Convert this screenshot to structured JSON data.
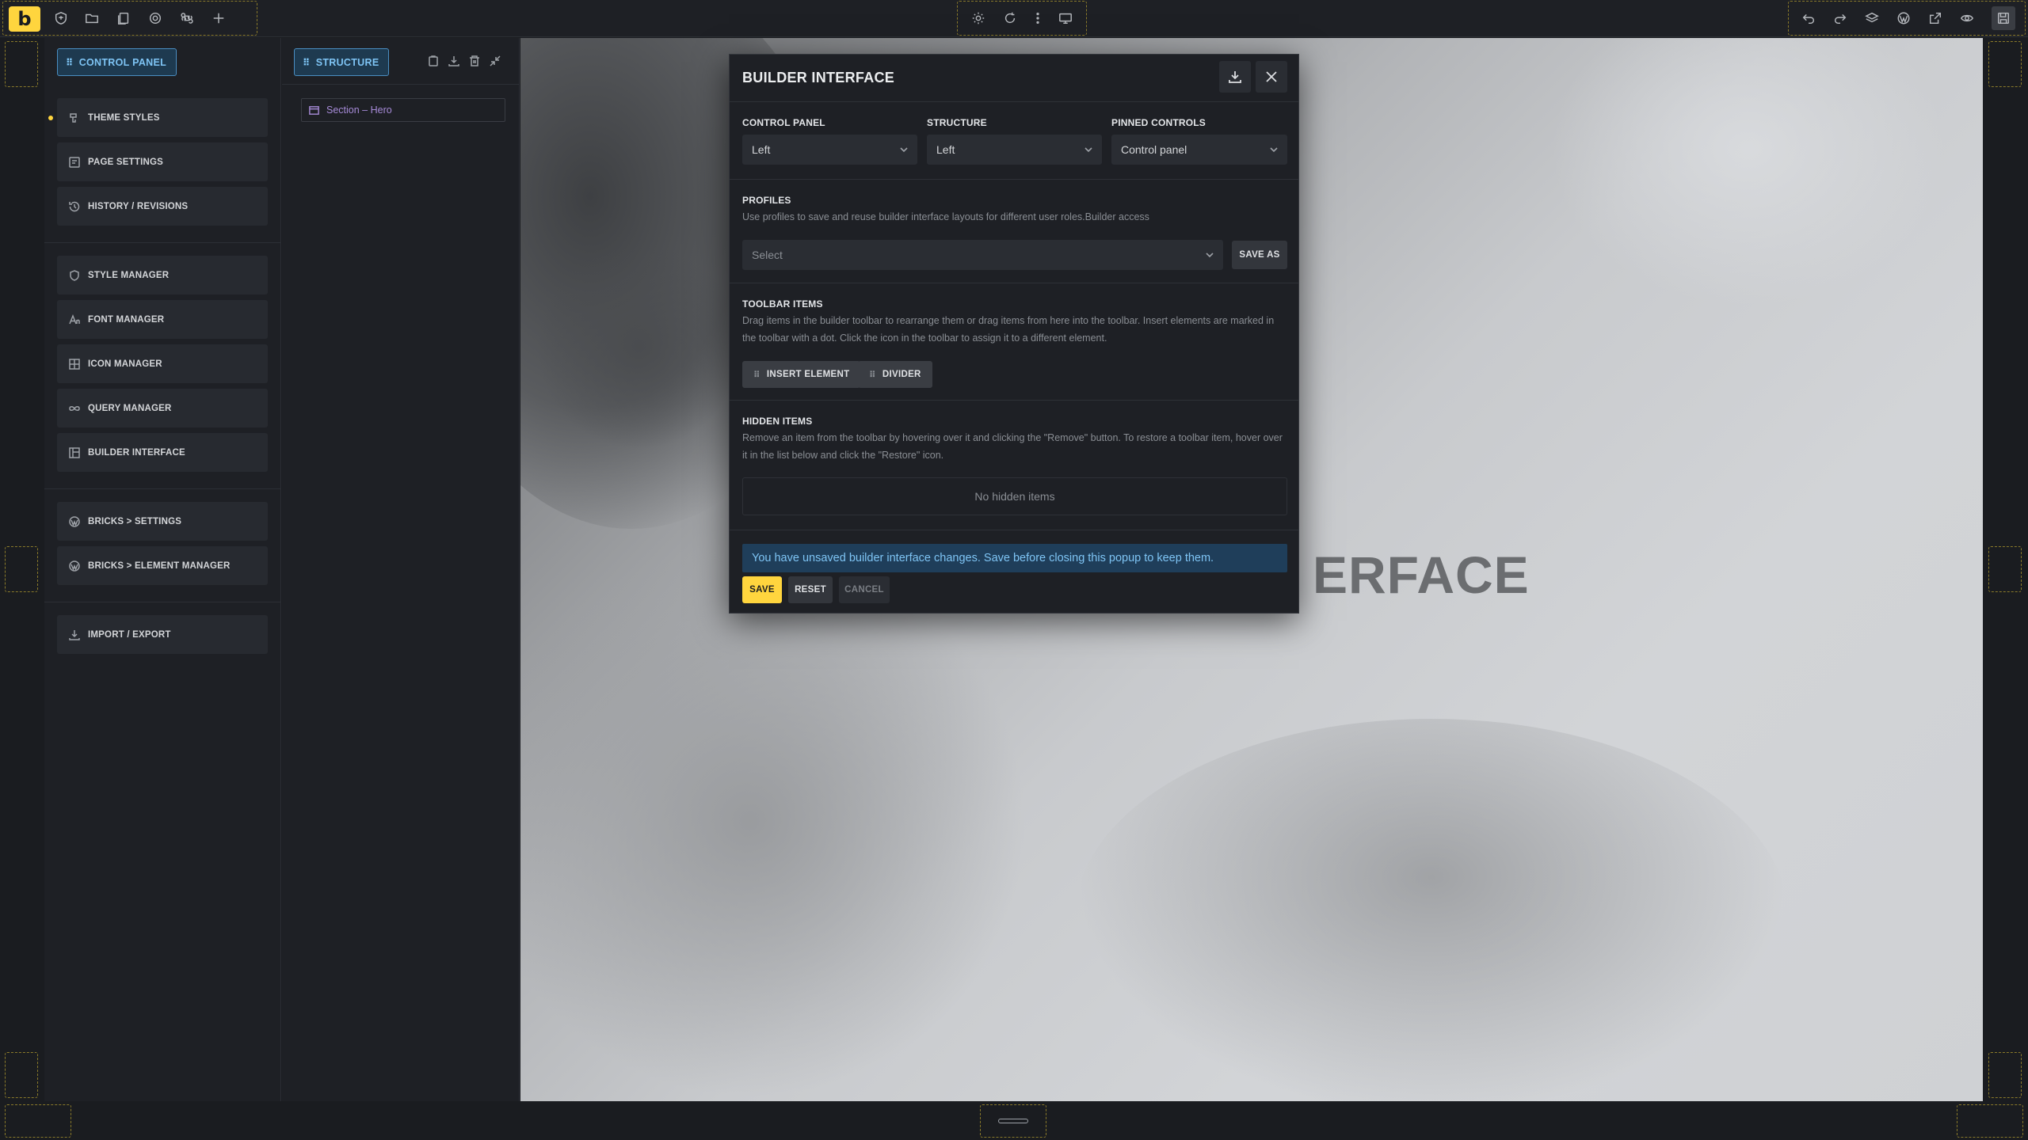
{
  "toolbar": {
    "logo": "b",
    "left_icons": [
      "shield-icon",
      "folder-icon",
      "pages-icon",
      "gear-icon",
      "command-icon",
      "plus-icon"
    ],
    "center_icons": [
      "sun-icon",
      "refresh-icon",
      "more-vertical-icon",
      "desktop-icon"
    ],
    "right_icons": [
      "undo-icon",
      "redo-icon",
      "layers-icon",
      "wordpress-icon",
      "external-link-icon",
      "eye-icon",
      "save-icon"
    ]
  },
  "control_panel": {
    "tab_label": "CONTROL PANEL",
    "groups": [
      [
        {
          "label": "THEME STYLES",
          "icon": "theme-icon"
        },
        {
          "label": "PAGE SETTINGS",
          "icon": "page-settings-icon"
        },
        {
          "label": "HISTORY / REVISIONS",
          "icon": "history-icon"
        }
      ],
      [
        {
          "label": "STYLE MANAGER",
          "icon": "shield-icon"
        },
        {
          "label": "FONT MANAGER",
          "icon": "font-icon"
        },
        {
          "label": "ICON MANAGER",
          "icon": "grid-icon"
        },
        {
          "label": "QUERY MANAGER",
          "icon": "infinity-icon"
        },
        {
          "label": "BUILDER INTERFACE",
          "icon": "layout-icon"
        }
      ],
      [
        {
          "label": "BRICKS > SETTINGS",
          "icon": "wordpress-icon"
        },
        {
          "label": "BRICKS > ELEMENT MANAGER",
          "icon": "wordpress-icon"
        }
      ],
      [
        {
          "label": "IMPORT / EXPORT",
          "icon": "download-icon"
        }
      ]
    ]
  },
  "structure": {
    "tab_label": "STRUCTURE",
    "node_label": "Section – Hero"
  },
  "canvas": {
    "hero_text": "ERFACE"
  },
  "modal": {
    "title": "BUILDER INTERFACE",
    "layout": {
      "control_panel_label": "CONTROL PANEL",
      "control_panel_value": "Left",
      "structure_label": "STRUCTURE",
      "structure_value": "Left",
      "pinned_label": "PINNED CONTROLS",
      "pinned_value": "Control panel"
    },
    "profiles": {
      "label": "PROFILES",
      "description": "Use profiles to save and reuse builder interface layouts for different user roles.Builder access",
      "select_placeholder": "Select",
      "save_as": "SAVE AS"
    },
    "toolbar_items": {
      "label": "TOOLBAR ITEMS",
      "description": "Drag items in the builder toolbar to rearrange them or drag items from here into the toolbar. Insert elements are marked in the toolbar with a dot. Click the icon in the toolbar to assign it to a different element.",
      "chips": [
        "INSERT ELEMENT",
        "DIVIDER"
      ]
    },
    "hidden_items": {
      "label": "HIDDEN ITEMS",
      "description": "Remove an item from the toolbar by hovering over it and clicking the \"Remove\" button. To restore a toolbar item, hover over it in the list below and click the \"Restore\" icon.",
      "empty": "No hidden items"
    },
    "notice": "You have unsaved builder interface changes. Save before closing this popup to keep them.",
    "buttons": {
      "save": "SAVE",
      "reset": "RESET",
      "cancel": "CANCEL"
    }
  },
  "colors": {
    "accent": "#ffd53e",
    "panel": "#1e2025",
    "info": "#7ec4f4"
  }
}
